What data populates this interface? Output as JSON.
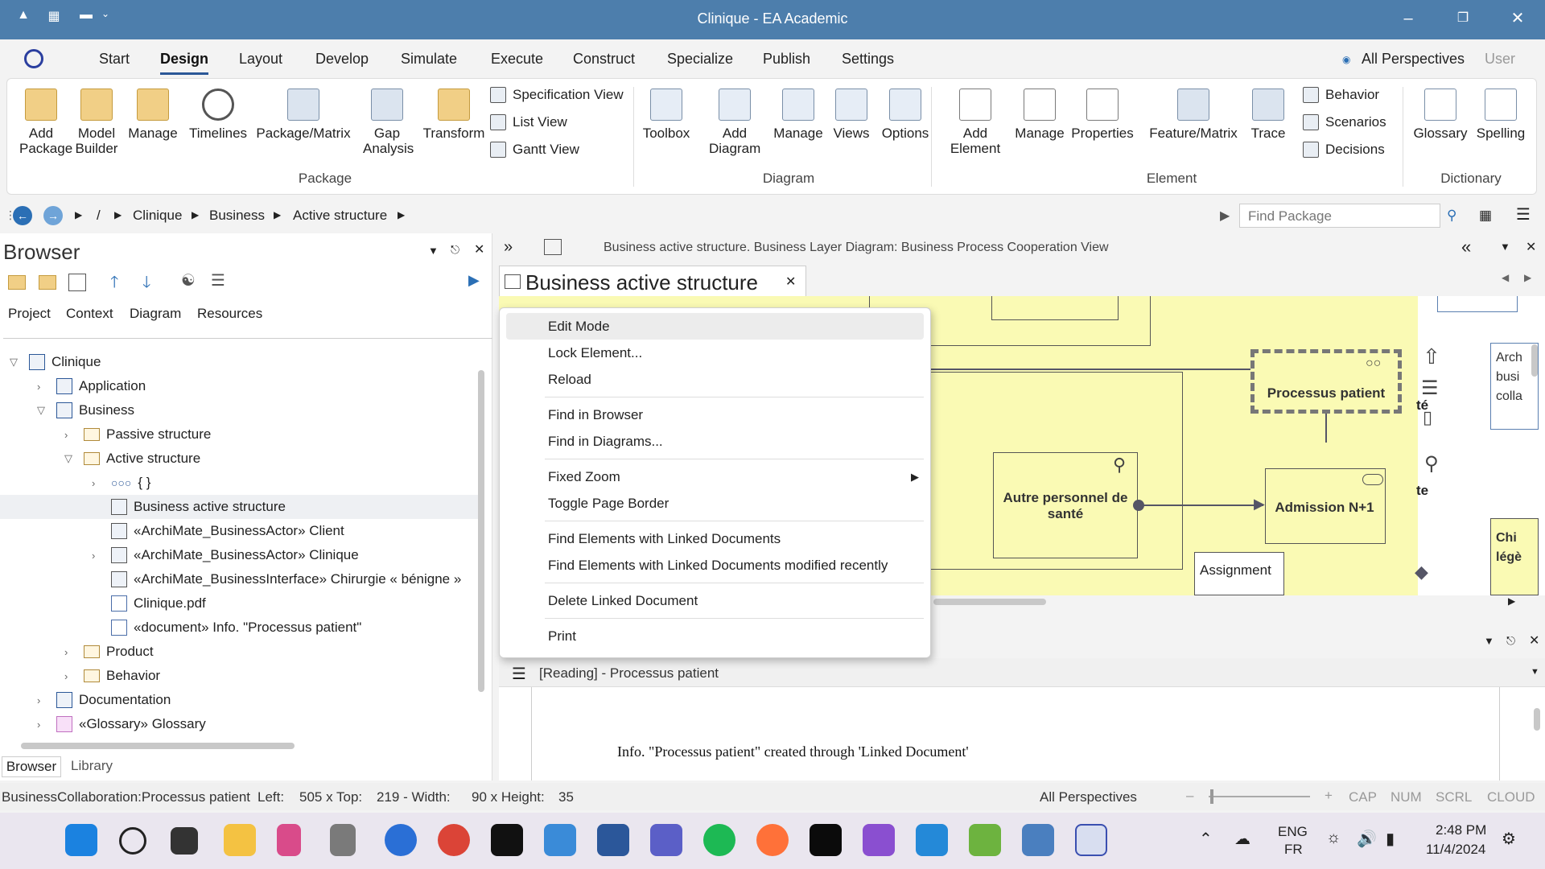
{
  "window": {
    "title": "Clinique - EA Academic"
  },
  "menu": {
    "tabs": [
      "Start",
      "Design",
      "Layout",
      "Develop",
      "Simulate",
      "Execute",
      "Construct",
      "Specialize",
      "Publish",
      "Settings"
    ],
    "active": "Design",
    "perspectives": "All Perspectives",
    "user": "User"
  },
  "ribbon": {
    "package": {
      "add_package": "Add Package",
      "model_builder": "Model Builder",
      "manage": "Manage",
      "timelines": "Timelines",
      "package_matrix": "Package/Matrix",
      "gap_analysis": "Gap Analysis",
      "transform": "Transform",
      "specification_view": "Specification View",
      "list_view": "List View",
      "gantt_view": "Gantt View",
      "label": "Package"
    },
    "diagram": {
      "toolbox": "Toolbox",
      "add_diagram": "Add Diagram",
      "manage": "Manage",
      "views": "Views",
      "options": "Options",
      "label": "Diagram"
    },
    "element": {
      "add_element": "Add Element",
      "manage": "Manage",
      "properties": "Properties",
      "feature_matrix": "Feature/Matrix",
      "trace": "Trace",
      "behavior": "Behavior",
      "scenarios": "Scenarios",
      "decisions": "Decisions",
      "label": "Element"
    },
    "dictionary": {
      "glossary": "Glossary",
      "spelling": "Spelling",
      "label": "Dictionary"
    }
  },
  "nav": {
    "root": "/",
    "crumbs": [
      "Clinique",
      "Business",
      "Active structure"
    ],
    "find_placeholder": "Find Package"
  },
  "browser": {
    "title": "Browser",
    "tabs": [
      "Project",
      "Context",
      "Diagram",
      "Resources"
    ],
    "tree": [
      {
        "label": "Clinique",
        "level": 0
      },
      {
        "label": "Application",
        "level": 1
      },
      {
        "label": "Business",
        "level": 1
      },
      {
        "label": "Passive structure",
        "level": 2
      },
      {
        "label": "Active structure",
        "level": 2
      },
      {
        "label": "{ }",
        "level": 3
      },
      {
        "label": "Business active structure",
        "level": 3
      },
      {
        "label": "«ArchiMate_BusinessActor» Client",
        "level": 3
      },
      {
        "label": "«ArchiMate_BusinessActor» Clinique",
        "level": 3
      },
      {
        "label": "«ArchiMate_BusinessInterface» Chirurgie « bénigne »",
        "level": 3
      },
      {
        "label": "Clinique.pdf",
        "level": 3
      },
      {
        "label": "«document» Info. \"Processus patient\"",
        "level": 3
      },
      {
        "label": "Product",
        "level": 2
      },
      {
        "label": "Behavior",
        "level": 2
      },
      {
        "label": "Documentation",
        "level": 1
      },
      {
        "label": "«Glossary» Glossary",
        "level": 1
      }
    ],
    "bottom_tabs": [
      "Browser",
      "Library"
    ]
  },
  "document": {
    "caption": "Business active structure.  Business Layer Diagram: Business Process Cooperation View",
    "tab_title": "Business active structure"
  },
  "diagram": {
    "elements": {
      "processus": "Processus patient",
      "autre": "Autre personnel de santé",
      "admission": "Admission N+1",
      "assignment": "Assignment",
      "frag_te1": "té",
      "frag_te2": "te",
      "arch": "Arch busi colla",
      "chi": "Chi légè"
    }
  },
  "context_menu": {
    "items": [
      "Edit Mode",
      "Lock Element...",
      "Reload",
      "Find in Browser",
      "Find in Diagrams...",
      "Fixed Zoom",
      "Toggle Page Border",
      "Find Elements with Linked Documents",
      "Find Elements with Linked Documents modified recently",
      "Delete Linked Document",
      "Print"
    ]
  },
  "doc_panel": {
    "header": "[Reading] - Processus patient",
    "body": "Info. \"Processus patient\" created through 'Linked Document'"
  },
  "status": {
    "selection": "BusinessCollaboration:Processus patient",
    "left": "Left:",
    "left_val": "505 x Top:",
    "top_val": "219 - Width:",
    "width_val": "90 x Height:",
    "height_val": "35",
    "perspectives": "All Perspectives",
    "cap": "CAP",
    "num": "NUM",
    "scrl": "SCRL",
    "cloud": "CLOUD"
  },
  "taskbar": {
    "lang1": "ENG",
    "lang2": "FR",
    "time": "2:48 PM",
    "date": "11/4/2024"
  },
  "colors": {
    "titlebar": "#4d7eac",
    "diagram_bg": "#fafab4",
    "accent": "#2b5797"
  }
}
